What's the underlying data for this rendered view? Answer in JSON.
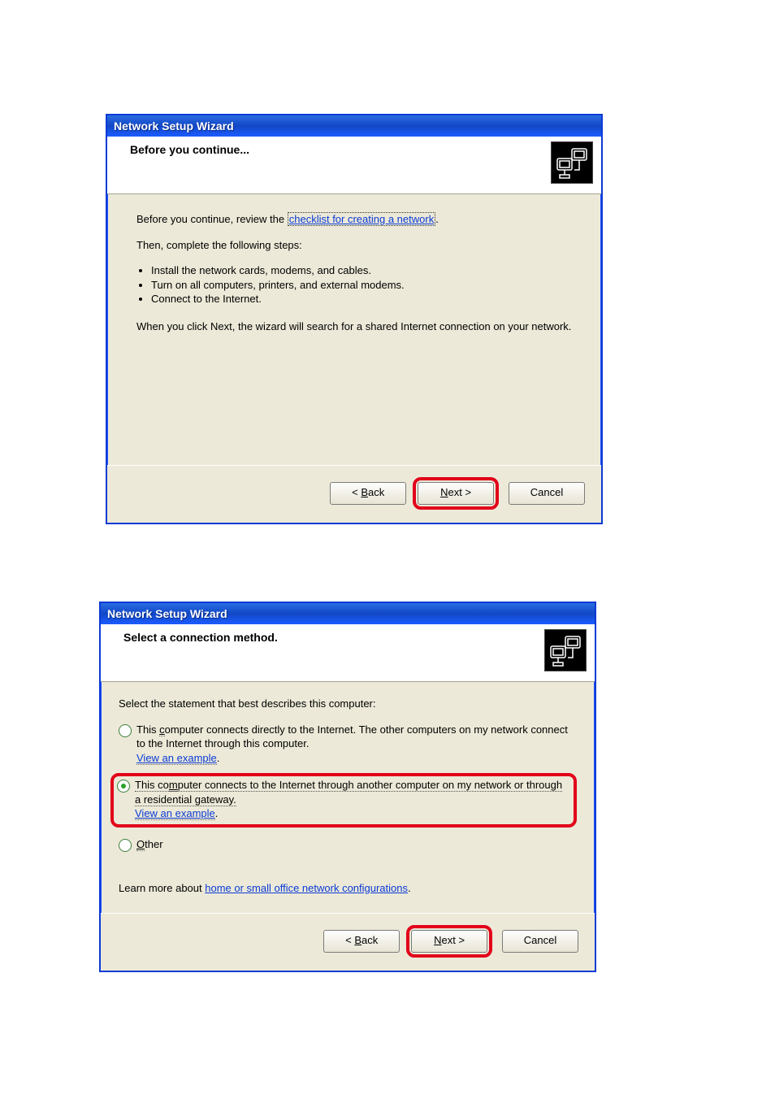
{
  "dialog1": {
    "title": "Network Setup Wizard",
    "header": "Before you continue...",
    "intro_prefix": "Before you continue, review the ",
    "intro_link": "checklist for creating a network",
    "intro_suffix": ".",
    "then_line": "Then, complete the following steps:",
    "steps": [
      "Install the network cards, modems, and cables.",
      "Turn on all computers, printers, and external modems.",
      "Connect to the Internet."
    ],
    "search_line": "When you click Next, the wizard will search for a shared Internet connection on your network.",
    "buttons": {
      "back": "< Back",
      "next": "Next >",
      "cancel": "Cancel"
    }
  },
  "dialog2": {
    "title": "Network Setup Wizard",
    "header": "Select a connection method.",
    "select_line": "Select the statement that best describes this computer:",
    "opt1_line1": "This computer connects directly to the Internet. The other computers on my network connect",
    "opt1_line2": "to the Internet through this computer.",
    "opt1_link": "View an example",
    "opt2_line1": "This computer connects to the Internet through another computer on my network or through",
    "opt2_line2": "a residential gateway.",
    "opt2_link": "View an example",
    "opt3_label": "Other",
    "learn_prefix": "Learn more about ",
    "learn_link": "home or small office network configurations",
    "learn_suffix": ".",
    "buttons": {
      "back": "< Back",
      "next": "Next >",
      "cancel": "Cancel"
    }
  }
}
